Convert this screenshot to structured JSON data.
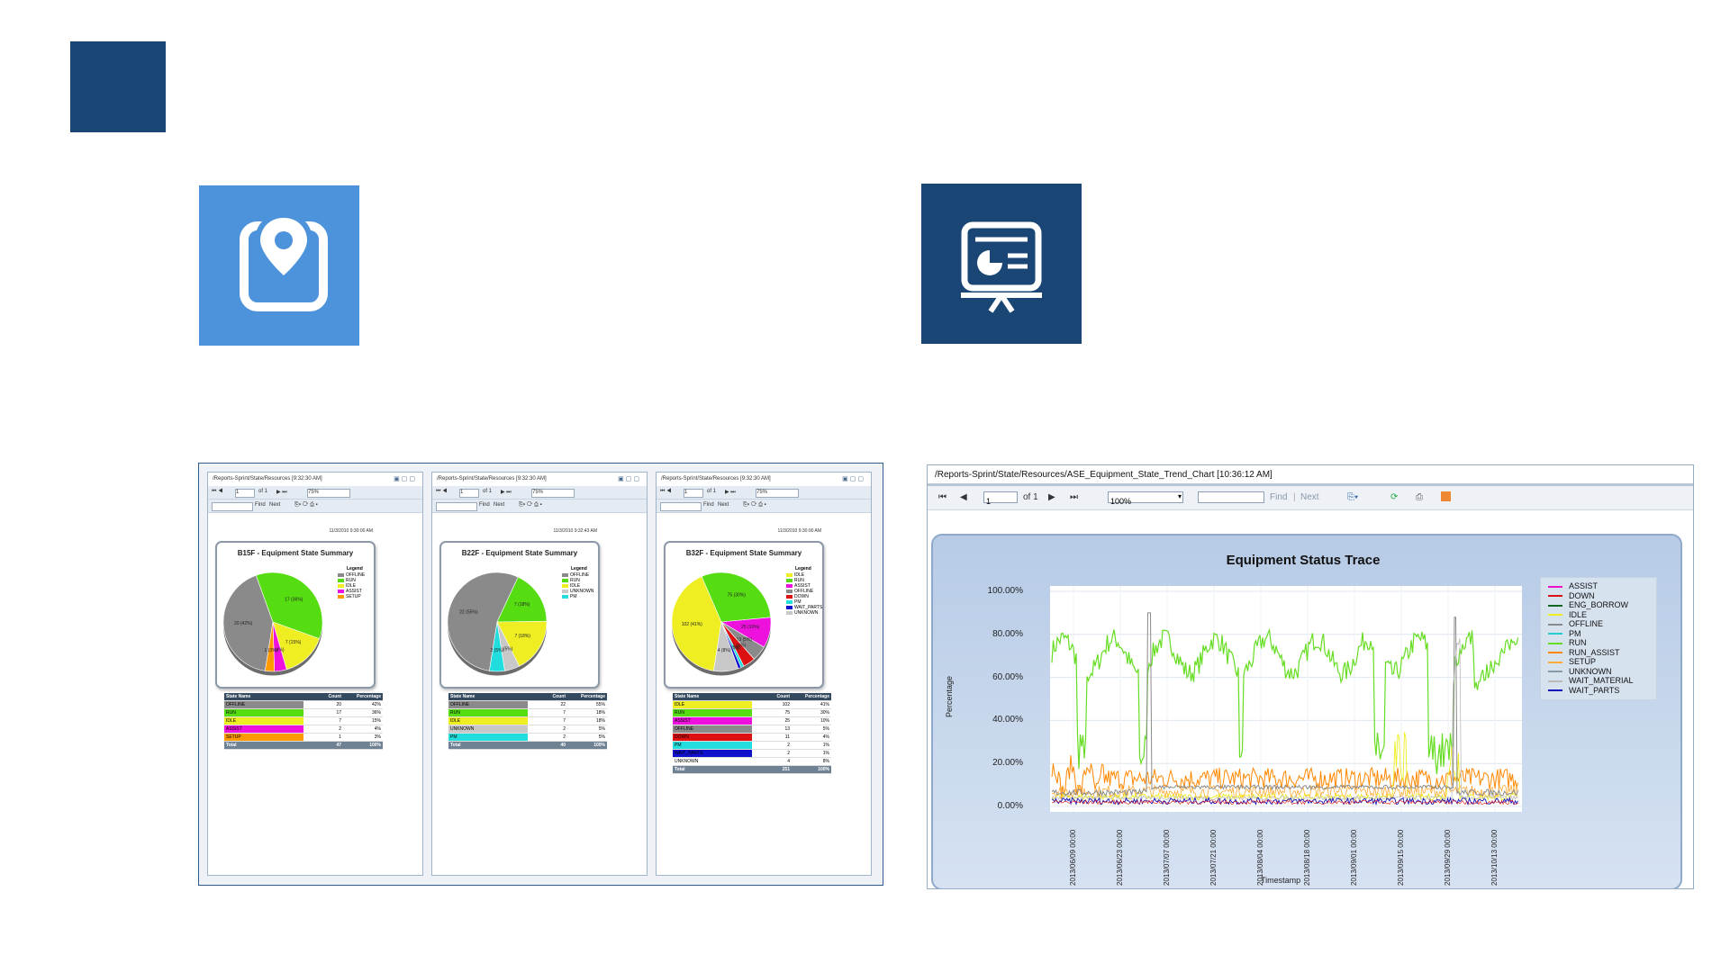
{
  "left_screenshot": {
    "panels": [
      {
        "path": "/Reports-Sprint/State/Resources [9:32:30 AM]",
        "page": "1",
        "of": "of 1",
        "zoom": "75%",
        "find": "Find",
        "next": "Next",
        "date": "11/3/2010 9:30:00 AM",
        "title": "B15F - Equipment State Summary",
        "legend_title": "Legend",
        "slices": [
          {
            "name": "OFFLINE",
            "value": 42,
            "color": "#8a8a8a",
            "label": "20 (42%)"
          },
          {
            "name": "RUN",
            "value": 36,
            "color": "#55dd11",
            "label": "17 (36%)"
          },
          {
            "name": "IDLE",
            "value": 15,
            "color": "#eeee22",
            "label": "7 (15%)"
          },
          {
            "name": "ASSIST",
            "value": 4,
            "color": "#ee11dd",
            "label": "2 (4%)"
          },
          {
            "name": "SETUP",
            "value": 3,
            "color": "#ff9900",
            "label": "1 (3%)"
          }
        ],
        "table_headers": [
          "State Name",
          "Count",
          "Percentage"
        ],
        "rows": [
          {
            "name": "OFFLINE",
            "count": "20",
            "pct": "42%",
            "color": "#8a8a8a"
          },
          {
            "name": "RUN",
            "count": "17",
            "pct": "36%",
            "color": "#55dd11"
          },
          {
            "name": "IDLE",
            "count": "7",
            "pct": "15%",
            "color": "#eeee22"
          },
          {
            "name": "ASSIST",
            "count": "2",
            "pct": "4%",
            "color": "#ee11dd"
          },
          {
            "name": "SETUP",
            "count": "1",
            "pct": "3%",
            "color": "#ff9900"
          }
        ],
        "total": {
          "name": "Total",
          "count": "47",
          "pct": "100%"
        }
      },
      {
        "path": "/Reports-Sprint/State/Resources [9:32:30 AM]",
        "page": "1",
        "of": "of 1",
        "zoom": "75%",
        "find": "Find",
        "next": "Next",
        "date": "11/3/2010 9:32:43 AM",
        "title": "B22F - Equipment State Summary",
        "legend_title": "Legend",
        "slices": [
          {
            "name": "OFFLINE",
            "value": 55,
            "color": "#8a8a8a",
            "label": "22 (55%)"
          },
          {
            "name": "RUN",
            "value": 18,
            "color": "#55dd11",
            "label": "7 (18%)"
          },
          {
            "name": "IDLE",
            "value": 18,
            "color": "#eeee22",
            "label": "7 (18%)"
          },
          {
            "name": "UNKNOWN",
            "value": 5,
            "color": "#c8c8c8",
            "label": "2 (5%)"
          },
          {
            "name": "PM",
            "value": 5,
            "color": "#22dddd",
            "label": "2 (5%)"
          }
        ],
        "table_headers": [
          "State Name",
          "Count",
          "Percentage"
        ],
        "rows": [
          {
            "name": "OFFLINE",
            "count": "22",
            "pct": "55%",
            "color": "#8a8a8a"
          },
          {
            "name": "RUN",
            "count": "7",
            "pct": "18%",
            "color": "#55dd11"
          },
          {
            "name": "IDLE",
            "count": "7",
            "pct": "18%",
            "color": "#eeee22"
          },
          {
            "name": "UNKNOWN",
            "count": "2",
            "pct": "5%",
            "color": "#c8c8c8"
          },
          {
            "name": "PM",
            "count": "2",
            "pct": "5%",
            "color": "#22dddd"
          }
        ],
        "total": {
          "name": "Total",
          "count": "40",
          "pct": "100%"
        }
      },
      {
        "path": "/Reports-Sprint/State/Resources [9:32:30 AM]",
        "page": "1",
        "of": "of 1",
        "zoom": "75%",
        "find": "Find",
        "next": "Next",
        "date": "11/3/2010 9:30:00 AM",
        "title": "B32F - Equipment State Summary",
        "legend_title": "Legend",
        "slices": [
          {
            "name": "IDLE",
            "value": 41,
            "color": "#eeee22",
            "label": "102 (41%)"
          },
          {
            "name": "RUN",
            "value": 30,
            "color": "#55dd11",
            "label": "75 (30%)"
          },
          {
            "name": "ASSIST",
            "value": 10,
            "color": "#ee11dd",
            "label": "25 (10%)"
          },
          {
            "name": "OFFLINE",
            "value": 5,
            "color": "#8a8a8a",
            "label": "13 (5%)"
          },
          {
            "name": "DOWN",
            "value": 4,
            "color": "#dd1111",
            "label": "11 (4%)"
          },
          {
            "name": "PM",
            "value": 1,
            "color": "#22dddd",
            "label": "2 (1%)"
          },
          {
            "name": "WAIT_PARTS",
            "value": 1,
            "color": "#1111cc",
            "label": "2 (1%)"
          },
          {
            "name": "UNKNOWN",
            "value": 8,
            "color": "#c8c8c8",
            "label": "4 (8%)"
          }
        ],
        "table_headers": [
          "State Name",
          "Count",
          "Percentage"
        ],
        "rows": [
          {
            "name": "IDLE",
            "count": "102",
            "pct": "41%",
            "color": "#eeee22"
          },
          {
            "name": "RUN",
            "count": "75",
            "pct": "30%",
            "color": "#55dd11"
          },
          {
            "name": "ASSIST",
            "count": "25",
            "pct": "10%",
            "color": "#ee11dd"
          },
          {
            "name": "OFFLINE",
            "count": "13",
            "pct": "5%",
            "color": "#8a8a8a"
          },
          {
            "name": "DOWN",
            "count": "11",
            "pct": "4%",
            "color": "#dd1111"
          },
          {
            "name": "PM",
            "count": "2",
            "pct": "1%",
            "color": "#22dddd"
          },
          {
            "name": "WAIT_PARTS",
            "count": "2",
            "pct": "1%",
            "color": "#1111cc"
          },
          {
            "name": "UNKNOWN",
            "count": "4",
            "pct": "8%",
            "color": "#ffffff"
          }
        ],
        "total": {
          "name": "Total",
          "count": "251",
          "pct": "100%"
        }
      }
    ]
  },
  "trend": {
    "path": "/Reports-Sprint/State/Resources/ASE_Equipment_State_Trend_Chart [10:36:12 AM]",
    "toolbar": {
      "page": "1",
      "of": "of 1",
      "zoom": "100%",
      "find": "Find",
      "next": "Next"
    },
    "title": "Equipment Status Trace",
    "ylabel": "Percentage",
    "xlabel": "Timestamp",
    "yticks": [
      "100.00%",
      "80.00%",
      "60.00%",
      "40.00%",
      "20.00%",
      "0.00%"
    ],
    "xticks": [
      "2013/06/09 00:00",
      "2013/06/23 00:00",
      "2013/07/07 00:00",
      "2013/07/21 00:00",
      "2013/08/04 00:00",
      "2013/08/18 00:00",
      "2013/09/01 00:00",
      "2013/09/15 00:00",
      "2013/09/29 00:00",
      "2013/10/13 00:00"
    ],
    "legend": [
      {
        "name": "ASSIST",
        "color": "#ee11cc"
      },
      {
        "name": "DOWN",
        "color": "#dd1111"
      },
      {
        "name": "ENG_BORROW",
        "color": "#116622"
      },
      {
        "name": "IDLE",
        "color": "#eeee22"
      },
      {
        "name": "OFFLINE",
        "color": "#8a8a8a"
      },
      {
        "name": "PM",
        "color": "#22cccc"
      },
      {
        "name": "RUN",
        "color": "#66dd22"
      },
      {
        "name": "RUN_ASSIST",
        "color": "#ff8800"
      },
      {
        "name": "SETUP",
        "color": "#ffaa33"
      },
      {
        "name": "UNKNOWN",
        "color": "#8899aa"
      },
      {
        "name": "WAIT_MATERIAL",
        "color": "#bbbbbb"
      },
      {
        "name": "WAIT_PARTS",
        "color": "#1111bb"
      }
    ]
  },
  "colors": {
    "navy": "#1a4676",
    "sky": "#4d93db"
  }
}
